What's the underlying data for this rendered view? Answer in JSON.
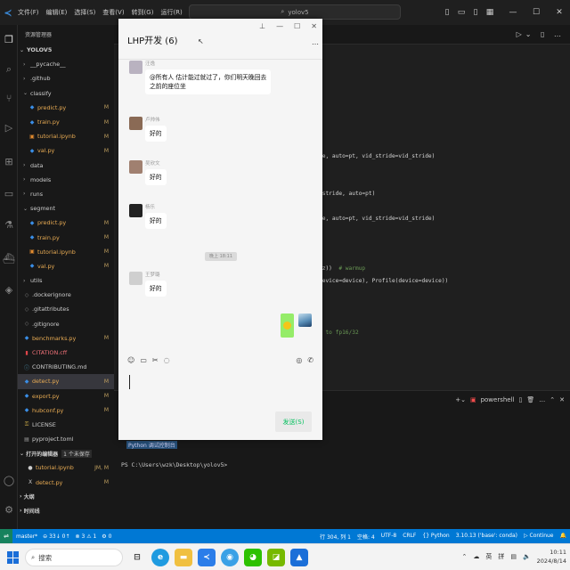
{
  "titlebar": {
    "menu": [
      "文件(F)",
      "编辑(E)",
      "选择(S)",
      "查看(V)",
      "转到(G)",
      "运行(R)",
      "..."
    ],
    "search": "yolov5"
  },
  "explorer": {
    "header": "资源管理器",
    "root": "YOLOV5",
    "items": [
      {
        "label": "__pycache__",
        "indent": 1,
        "type": "folder"
      },
      {
        "label": ".github",
        "indent": 1,
        "type": "folder"
      },
      {
        "label": "classify",
        "indent": 1,
        "type": "folder-open"
      },
      {
        "label": "predict.py",
        "indent": 2,
        "type": "py",
        "badge": "M"
      },
      {
        "label": "train.py",
        "indent": 2,
        "type": "py",
        "badge": "M"
      },
      {
        "label": "tutorial.ipynb",
        "indent": 2,
        "type": "nb",
        "badge": "M"
      },
      {
        "label": "val.py",
        "indent": 2,
        "type": "py",
        "badge": "M"
      },
      {
        "label": "data",
        "indent": 1,
        "type": "folder"
      },
      {
        "label": "models",
        "indent": 1,
        "type": "folder"
      },
      {
        "label": "runs",
        "indent": 1,
        "type": "folder"
      },
      {
        "label": "segment",
        "indent": 1,
        "type": "folder-open"
      },
      {
        "label": "predict.py",
        "indent": 2,
        "type": "py",
        "badge": "M"
      },
      {
        "label": "train.py",
        "indent": 2,
        "type": "py",
        "badge": "M"
      },
      {
        "label": "tutorial.ipynb",
        "indent": 2,
        "type": "nb",
        "badge": "M"
      },
      {
        "label": "val.py",
        "indent": 2,
        "type": "py",
        "badge": "M"
      },
      {
        "label": "utils",
        "indent": 1,
        "type": "folder"
      },
      {
        "label": ".dockerignore",
        "indent": 1,
        "type": "file"
      },
      {
        "label": ".gitattributes",
        "indent": 1,
        "type": "file"
      },
      {
        "label": ".gitignore",
        "indent": 1,
        "type": "file"
      },
      {
        "label": "benchmarks.py",
        "indent": 1,
        "type": "py",
        "badge": "M"
      },
      {
        "label": "CITATION.cff",
        "indent": 1,
        "type": "cff"
      },
      {
        "label": "CONTRIBUTING.md",
        "indent": 1,
        "type": "md"
      },
      {
        "label": "detect.py",
        "indent": 1,
        "type": "py",
        "badge": "M",
        "selected": true
      },
      {
        "label": "export.py",
        "indent": 1,
        "type": "py",
        "badge": "M"
      },
      {
        "label": "hubconf.py",
        "indent": 1,
        "type": "py",
        "badge": "M"
      },
      {
        "label": "LICENSE",
        "indent": 1,
        "type": "lic"
      },
      {
        "label": "pyproject.toml",
        "indent": 1,
        "type": "toml"
      }
    ],
    "open_editors_label": "打开的编辑器",
    "open_editors_count": "1 个未保存",
    "open_editors": [
      {
        "label": "tutorial.ipynb",
        "badge": "JM, M",
        "marker": "●"
      },
      {
        "label": "detect.py",
        "badge": "M",
        "marker": "X"
      }
    ],
    "outline_label": "大纲",
    "timeline_label": "时间线"
  },
  "code_lines": [
    {
      "text": "de, auto=pt, vid_stride=vid_stride)",
      "comment": ""
    },
    {
      "text": "=stride, auto=pt)",
      "comment": ""
    },
    {
      "text": "de, auto=pt, vid_stride=vid_stride)",
      "comment": ""
    },
    {
      "text": "sz))  ",
      "comment": "# warmup"
    },
    {
      "text": "device=device), Profile(device=device))",
      "comment": ""
    },
    {
      "text": "",
      "comment": "3 to fp16/32"
    }
  ],
  "terminal": {
    "shell": "powershell",
    "highlight": "Python 调试控制台",
    "prompt": "PS C:\\Users\\wzk\\Desktop\\yolov5>"
  },
  "status": {
    "left": [
      "master*",
      "⊖ 33↓ 0↑",
      "⊗ 3 ⚠ 1",
      "⚙ 0"
    ],
    "right": [
      "行 304, 列 1",
      "空格: 4",
      "UTF-8",
      "CRLF",
      "{} Python",
      "3.10.13 ('base': conda)",
      "▷ Continue"
    ]
  },
  "chat": {
    "title": "LHP开发 (6)",
    "messages": [
      {
        "name": "汪逸",
        "text": "@所有人 估计能过就过了，你们明天晚回去",
        "text2": "之前的座位坐",
        "avatar": "#b9b2c0"
      },
      {
        "name": "卢帅伟",
        "text": "好的",
        "avatar": "#8a6a55"
      },
      {
        "name": "吴欣文",
        "text": "好的",
        "avatar": "#a08070"
      },
      {
        "name": "杨乐",
        "text": "好的",
        "avatar": "#222222"
      },
      {
        "name": "王梦璐",
        "text": "好的",
        "avatar": "#cfcfcf"
      }
    ],
    "time": "晚上 18:11",
    "send_label": "发送(S)"
  },
  "taskbar": {
    "search_placeholder": "搜索",
    "tray": [
      "英",
      "拼"
    ],
    "time": "10:11",
    "date": "2024/8/14"
  }
}
